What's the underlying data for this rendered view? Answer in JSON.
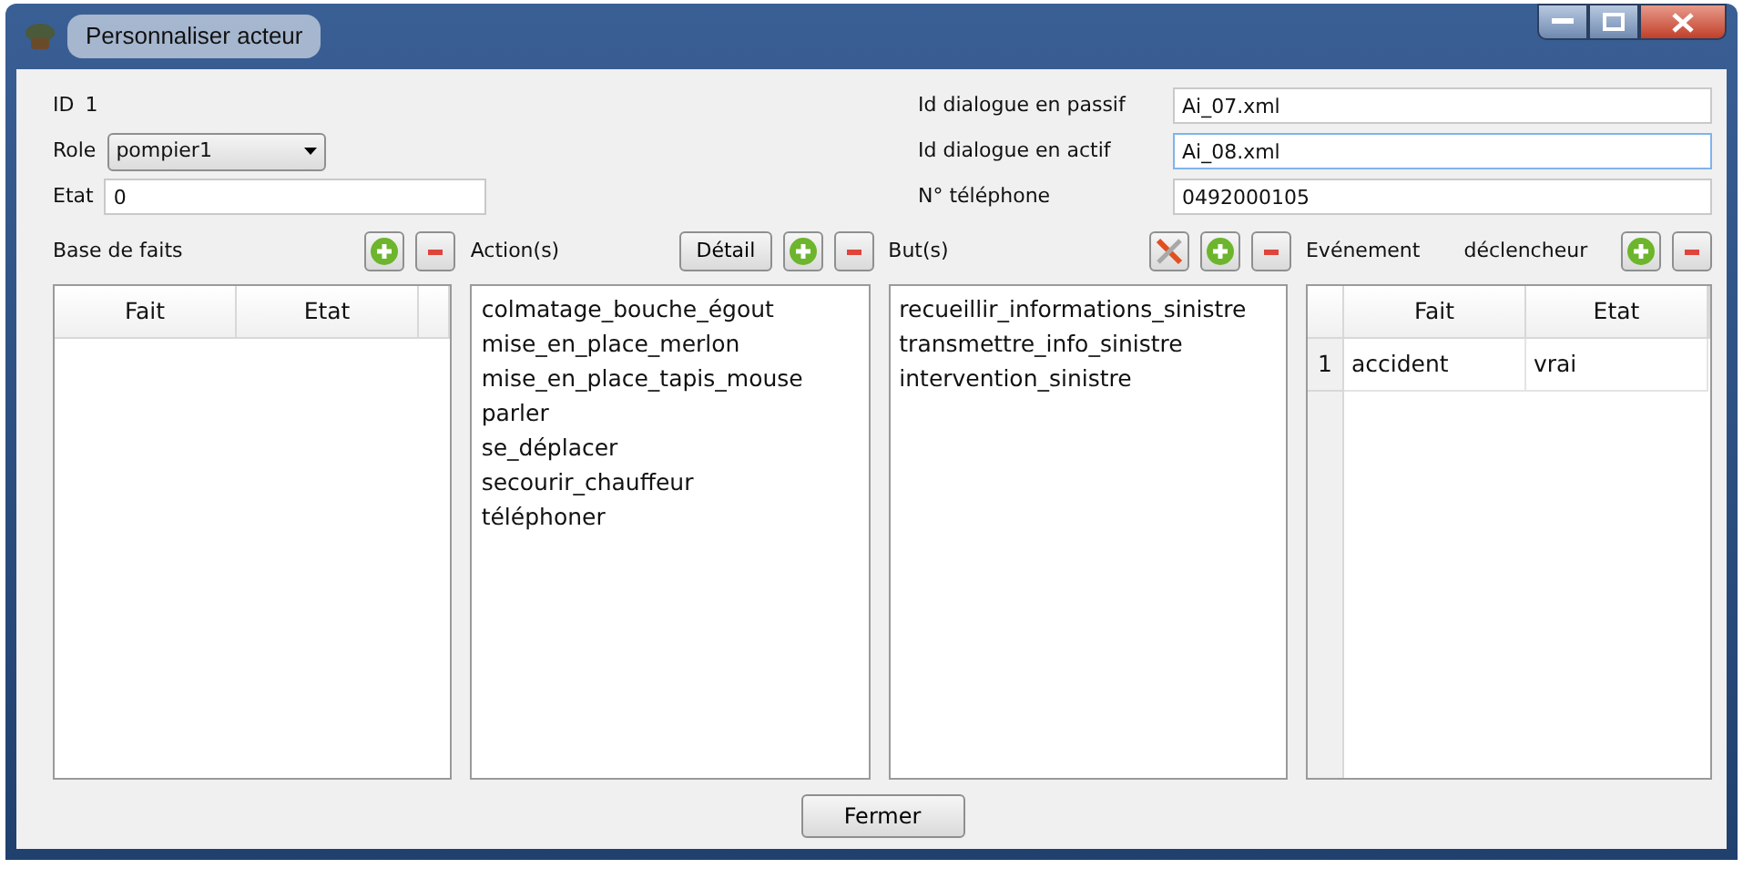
{
  "window": {
    "title": "Personnaliser acteur"
  },
  "left_fields": [
    {
      "kind": "text",
      "label": "ID",
      "value": "1"
    },
    {
      "kind": "select",
      "label": "Role",
      "value": "pompier1"
    },
    {
      "kind": "input",
      "label": "Etat",
      "value": "0"
    }
  ],
  "right_fields": [
    {
      "label": "Id dialogue en passif",
      "value": "Ai_07.xml",
      "focused": false
    },
    {
      "label": "Id dialogue en actif",
      "value": "Ai_08.xml",
      "focused": true
    },
    {
      "label": "N° téléphone",
      "value": "0492000105",
      "focused": false
    }
  ],
  "panels": [
    {
      "kind": "table",
      "titles": [
        "Base de faits"
      ],
      "buttons": [
        {
          "kind": "add"
        },
        {
          "kind": "remove"
        }
      ],
      "columns": [
        "Fait",
        "Etat"
      ]
    },
    {
      "kind": "list",
      "titles": [
        "Action(s)"
      ],
      "buttons": [
        {
          "kind": "text",
          "label": "Détail"
        },
        {
          "kind": "add"
        },
        {
          "kind": "remove"
        }
      ],
      "items": [
        "colmatage_bouche_égout",
        "mise_en_place_merlon",
        "mise_en_place_tapis_mouse",
        "parler",
        "se_déplacer",
        "secourir_chauffeur",
        "téléphoner"
      ]
    },
    {
      "kind": "list",
      "titles": [
        "But(s)"
      ],
      "buttons": [
        {
          "kind": "clear"
        },
        {
          "kind": "add"
        },
        {
          "kind": "remove"
        }
      ],
      "items": [
        "recueillir_informations_sinistre",
        "transmettre_info_sinistre",
        "intervention_sinistre"
      ]
    },
    {
      "kind": "table",
      "titles": [
        "Evénement",
        "déclencheur"
      ],
      "buttons": [
        {
          "kind": "add"
        },
        {
          "kind": "remove"
        }
      ],
      "columns": [
        "Fait",
        "Etat"
      ],
      "rows": [
        {
          "number": "1",
          "cells": [
            "accident",
            "vrai"
          ]
        }
      ]
    }
  ],
  "footer": {
    "button": "Fermer"
  }
}
